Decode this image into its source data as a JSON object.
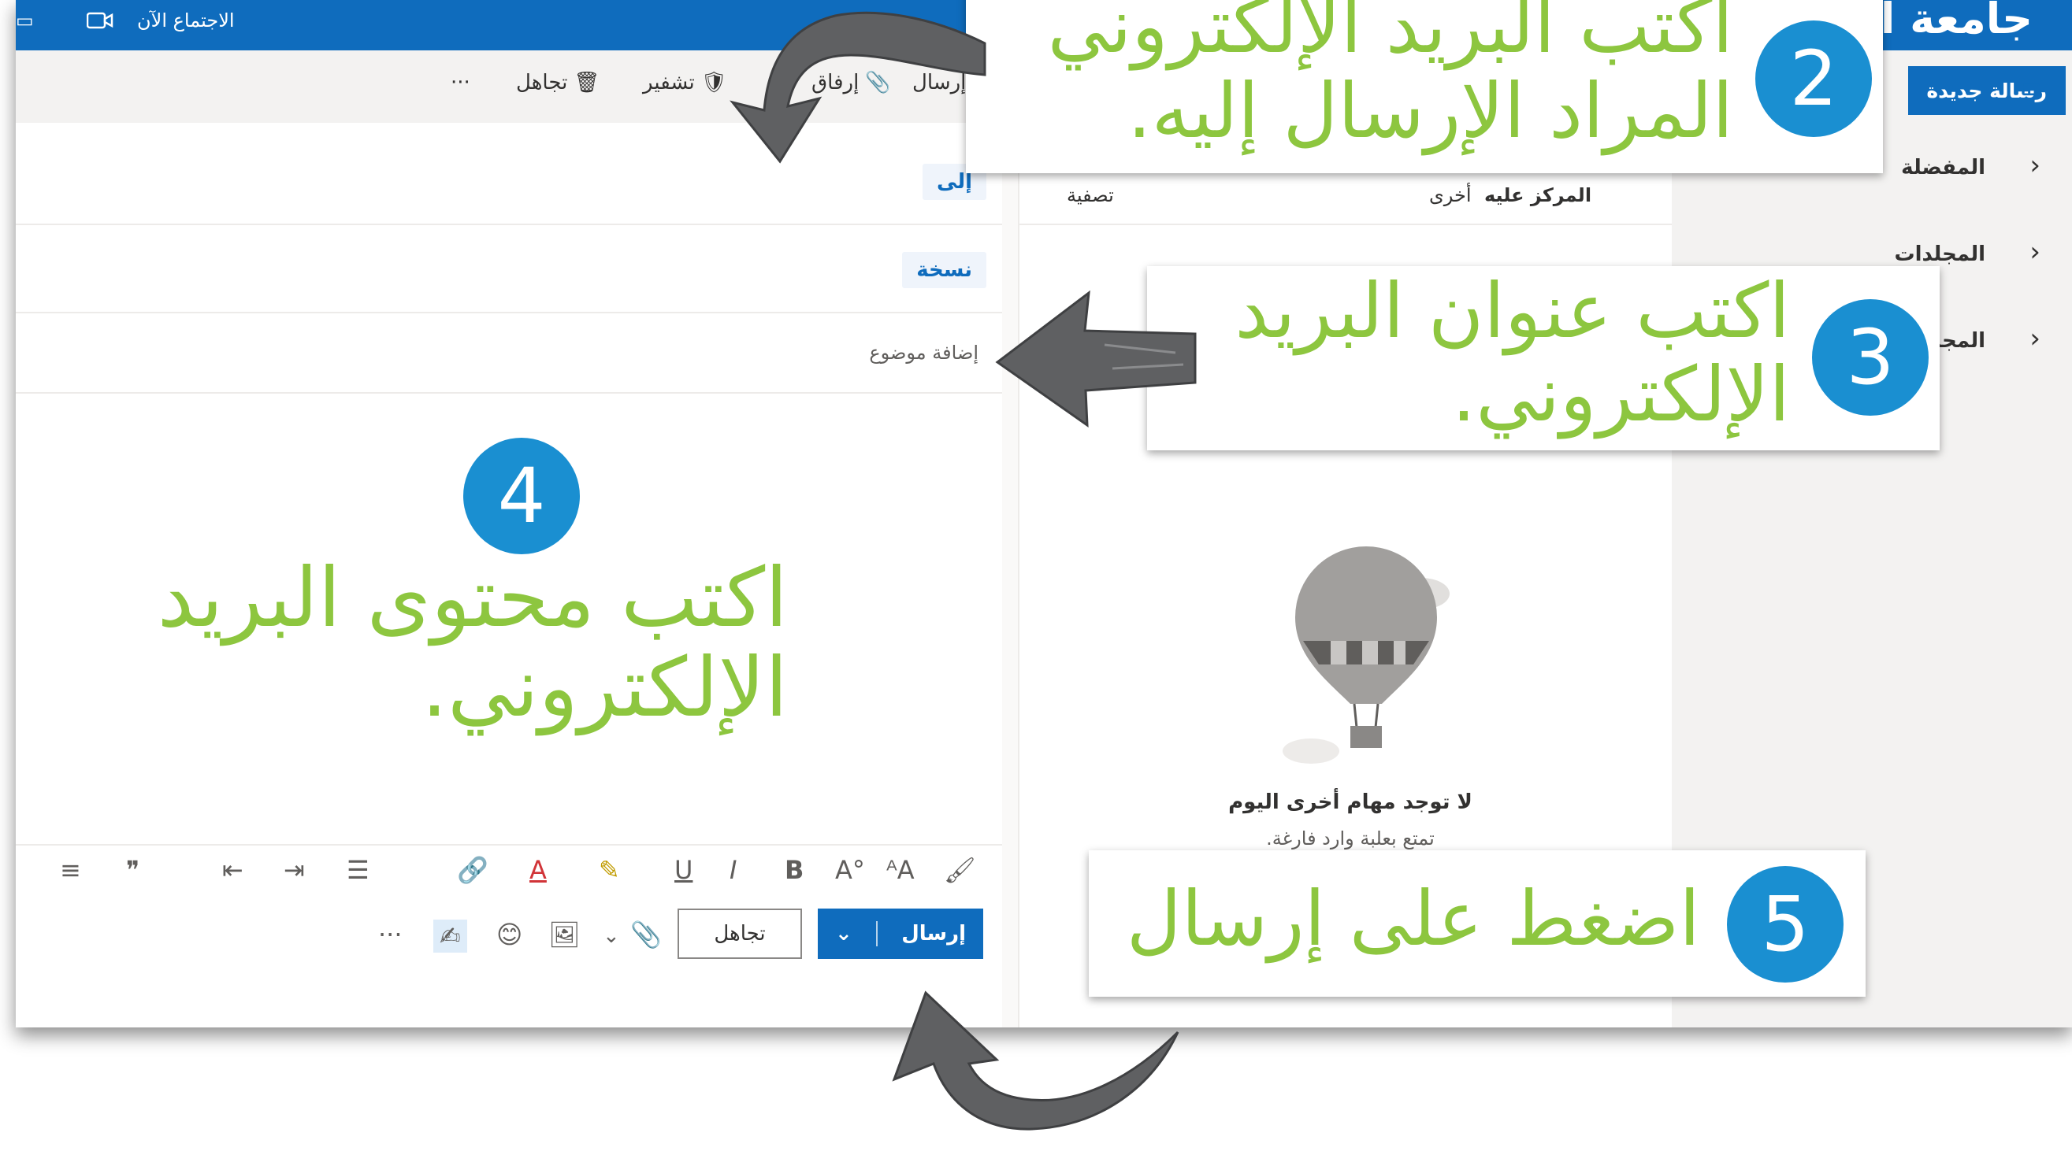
{
  "topbar": {
    "meet_now": "الاجتماع الآن",
    "org_title": "جامعة ا"
  },
  "compose": {
    "toolbar": {
      "send": "إرسال",
      "attach": "إرفاق",
      "encrypt": "تشفير",
      "discard": "تجاهل",
      "more": "···"
    },
    "to_label": "إلى",
    "cc_label": "نسخة",
    "subject_placeholder": "إضافة موضوع",
    "format_icons": [
      "B",
      "I",
      "U",
      "A",
      "≡",
      "❞"
    ],
    "actions": {
      "send": "إرسال",
      "discard": "تجاهل",
      "more": "···"
    }
  },
  "list": {
    "tabs": [
      "المركز عليه",
      "أخرى",
      "تصفية"
    ],
    "empty_title": "لا توجد مهام أخرى اليوم",
    "empty_sub": "تمتع بعلبة وارد فارغة."
  },
  "nav": {
    "new_message": "رسالة جديدة",
    "items": [
      "المفضلة",
      "المجلدات",
      "المجموعات"
    ]
  },
  "annotations": {
    "step2": {
      "number": "2",
      "lines": [
        "اكتب البريد الإلكتروني",
        "المراد الإرسال إليه."
      ]
    },
    "step3": {
      "number": "3",
      "lines": [
        "اكتب عنوان البريد",
        "الإلكتروني."
      ]
    },
    "step4": {
      "number": "4",
      "lines": [
        "اكتب محتوى البريد",
        "الإلكتروني."
      ]
    },
    "step5": {
      "number": "5",
      "lines": [
        "اضغط على إرسال"
      ]
    }
  },
  "colors": {
    "brand_blue": "#0f6cbd",
    "annotation_green": "#8dc63f",
    "badge_blue": "#1a8fd1",
    "arrow_gray": "#5f6062"
  }
}
